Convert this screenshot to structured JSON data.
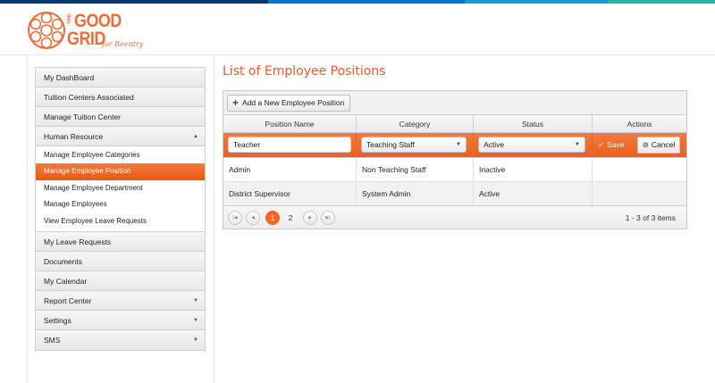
{
  "colors": {
    "accent": "#f26522",
    "title": "#f05a28",
    "topbar": [
      "#003a70",
      "#0078c8",
      "#1a9ad6",
      "#2bb3a8"
    ]
  },
  "logo": {
    "the": "THE",
    "good": "GOOD",
    "grid": "GRID",
    "tagline": "for Reentry"
  },
  "sidebar": {
    "items_top": [
      {
        "label": "My DashBoard"
      },
      {
        "label": "Tuition Centers Associated"
      },
      {
        "label": "Manage Tuition Center"
      }
    ],
    "human_resource": {
      "label": "Human Resource",
      "caret": "▲"
    },
    "sub_items": [
      {
        "label": "Manage Employee Categories"
      },
      {
        "label": "Manage Employee Position"
      },
      {
        "label": "Manage Employee Department"
      },
      {
        "label": "Manage Employees"
      },
      {
        "label": "View Employee Leave Requests"
      }
    ],
    "items_bottom": [
      {
        "label": "My Leave Requests",
        "caret": ""
      },
      {
        "label": "Documents",
        "caret": ""
      },
      {
        "label": "My Calendar",
        "caret": ""
      },
      {
        "label": "Report Center",
        "caret": "▼"
      },
      {
        "label": "Settings",
        "caret": "▼"
      },
      {
        "label": "SMS",
        "caret": "▼"
      }
    ]
  },
  "main": {
    "title": "List of Employee Positions",
    "add_button": "Add a New Employee Position",
    "columns": [
      "Position Name",
      "Category",
      "Status",
      "Actions"
    ],
    "edit_row": {
      "position_name": "Teacher",
      "category": "Teaching Staff",
      "status": "Active",
      "save": "Save",
      "cancel": "Cancel"
    },
    "rows": [
      {
        "position": "Admin",
        "category": "Non Teaching Staff",
        "status": "Inactive"
      },
      {
        "position": "District Supervisor",
        "category": "System Admin",
        "status": "Active"
      }
    ],
    "pager": {
      "pages": [
        "1",
        "2"
      ],
      "current": "1",
      "info": "1 - 3 of 3 items"
    }
  }
}
